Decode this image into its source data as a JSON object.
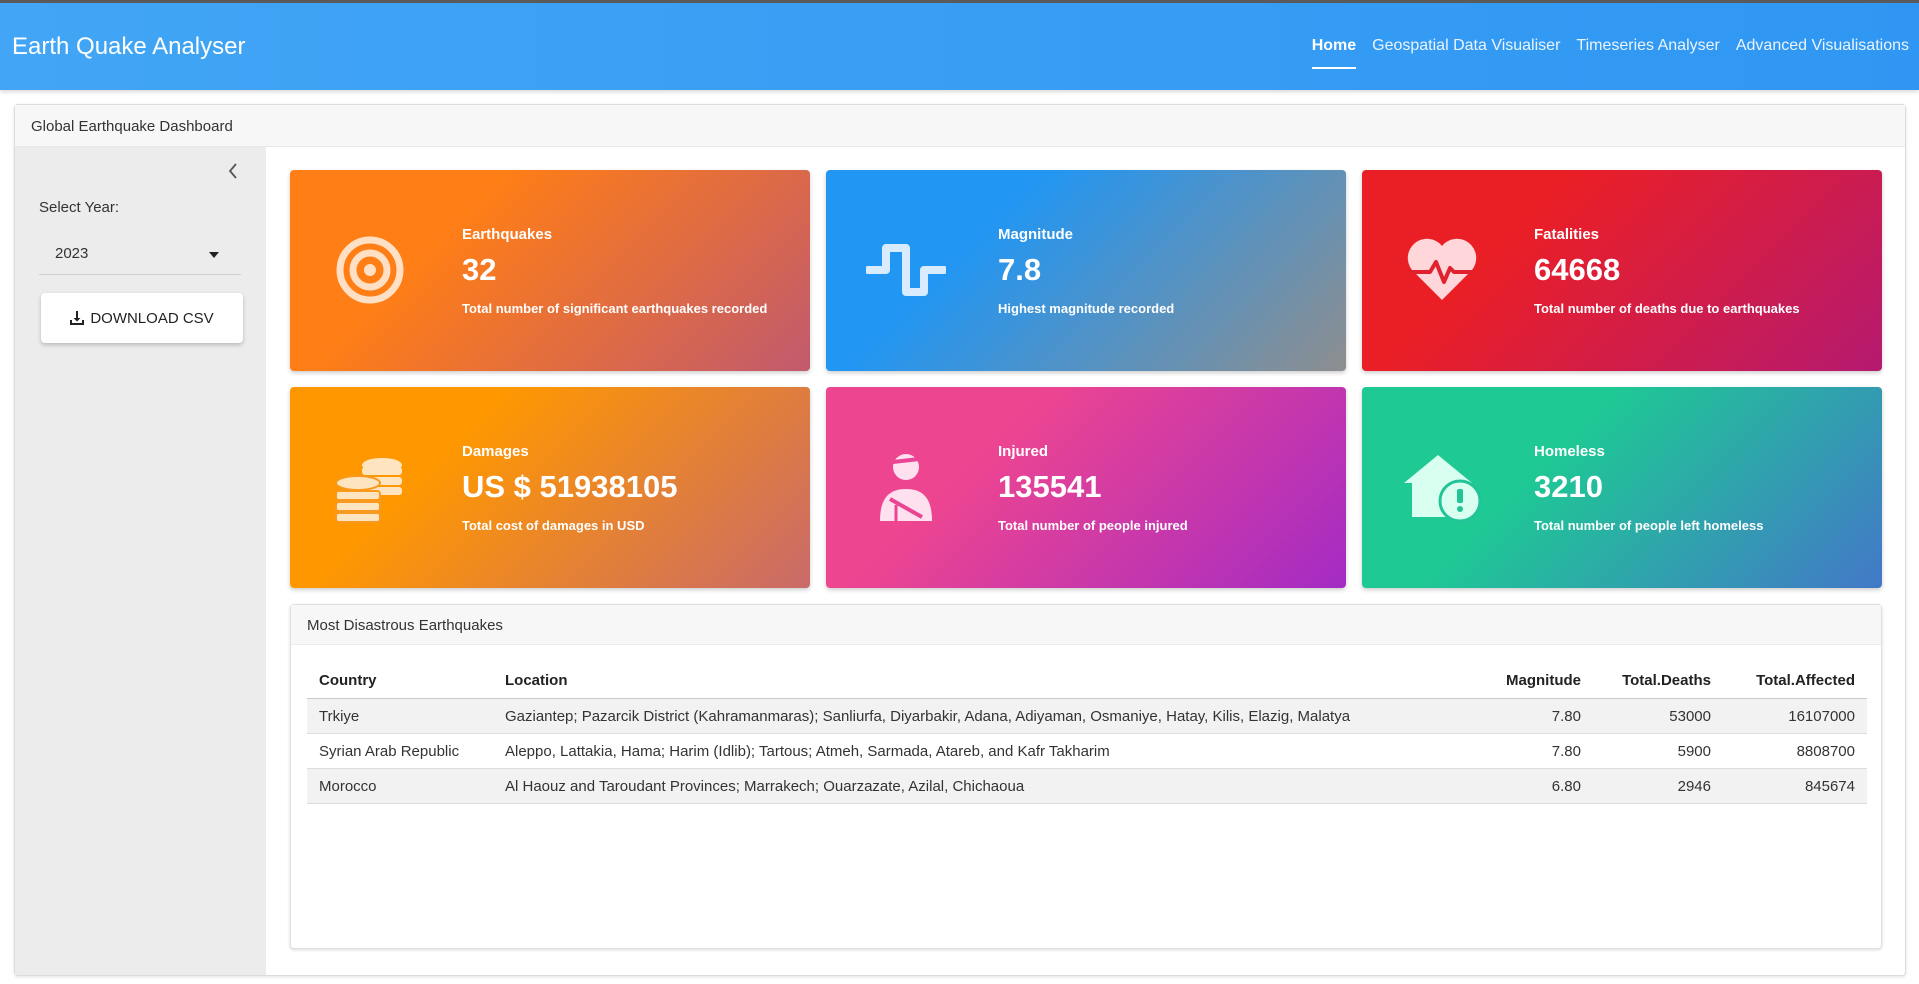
{
  "app": {
    "title": "Earth Quake Analyser"
  },
  "nav": [
    {
      "label": "Home",
      "active": true
    },
    {
      "label": "Geospatial Data Visualiser",
      "active": false
    },
    {
      "label": "Timeseries Analyser",
      "active": false
    },
    {
      "label": "Advanced Visualisations",
      "active": false
    }
  ],
  "dashboard": {
    "title": "Global Earthquake Dashboard"
  },
  "sidebar": {
    "collapse_icon": "chevron-left-icon",
    "year_label": "Select Year:",
    "year_value": "2023",
    "download_label": "DOWNLOAD CSV",
    "download_icon": "download-icon"
  },
  "value_boxes": [
    {
      "title": "Earthquakes",
      "value": "32",
      "subtitle": "Total number of significant earthquakes recorded",
      "icon": "bullseye-icon",
      "colors": [
        "#ff7e16",
        "#c15a6e"
      ]
    },
    {
      "title": "Magnitude",
      "value": "7.8",
      "subtitle": "Highest magnitude recorded",
      "icon": "wave-square-icon",
      "colors": [
        "#2196f3",
        "#8e8e8e"
      ]
    },
    {
      "title": "Fatalities",
      "value": "64668",
      "subtitle": "Total number of deaths due to earthquakes",
      "icon": "heart-pulse-icon",
      "colors": [
        "#ea1f26",
        "#b51a70"
      ]
    },
    {
      "title": "Damages",
      "value": "US $ 51938105",
      "subtitle": "Total cost of damages in USD",
      "icon": "coins-icon",
      "colors": [
        "#ff9800",
        "#c96a6a"
      ]
    },
    {
      "title": "Injured",
      "value": "135541",
      "subtitle": "Total number of people injured",
      "icon": "user-injured-icon",
      "colors": [
        "#ee4590",
        "#a32bc4"
      ]
    },
    {
      "title": "Homeless",
      "value": "3210",
      "subtitle": "Total number of people left homeless",
      "icon": "house-exclamation-icon",
      "colors": [
        "#1ec994",
        "#4378c8"
      ]
    }
  ],
  "table": {
    "title": "Most Disastrous Earthquakes",
    "columns": [
      "Country",
      "Location",
      "Magnitude",
      "Total.Deaths",
      "Total.Affected"
    ],
    "rows": [
      [
        "Trkiye",
        "Gaziantep; Pazarcik District (Kahramanmaras); Sanliurfa, Diyarbakir, Adana, Adiyaman, Osmaniye, Hatay, Kilis, Elazig, Malatya",
        "7.80",
        "53000",
        "16107000"
      ],
      [
        "Syrian Arab Republic",
        "Aleppo, Lattakia, Hama; Harim (Idlib); Tartous; Atmeh, Sarmada, Atareb, and Kafr Takharim",
        "7.80",
        "5900",
        "8808700"
      ],
      [
        "Morocco",
        "Al Haouz and Taroudant Provinces; Marrakech; Ouarzazate, Azilal, Chichaoua",
        "6.80",
        "2946",
        "845674"
      ]
    ]
  }
}
